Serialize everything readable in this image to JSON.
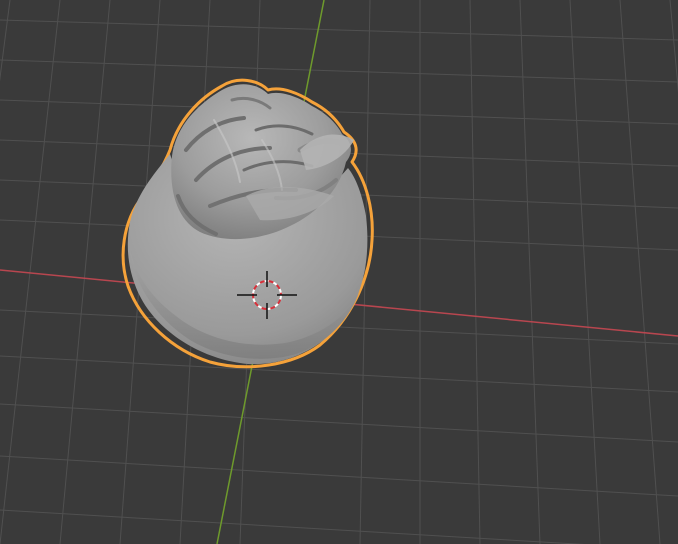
{
  "viewport": {
    "background": "#3a3a3a",
    "grid_color": "#505050",
    "x_axis_color": "#b8464f",
    "y_axis_color": "#6e9a2c"
  },
  "object": {
    "name": "",
    "selected": true,
    "outline_color": "#f5a23a",
    "base_color": "#9e9e9e",
    "shadow_color": "#6a6a6a",
    "highlight_color": "#c2c2c2"
  },
  "cursor": {
    "ring_color": "#d8303a",
    "cross_color": "#111111"
  }
}
